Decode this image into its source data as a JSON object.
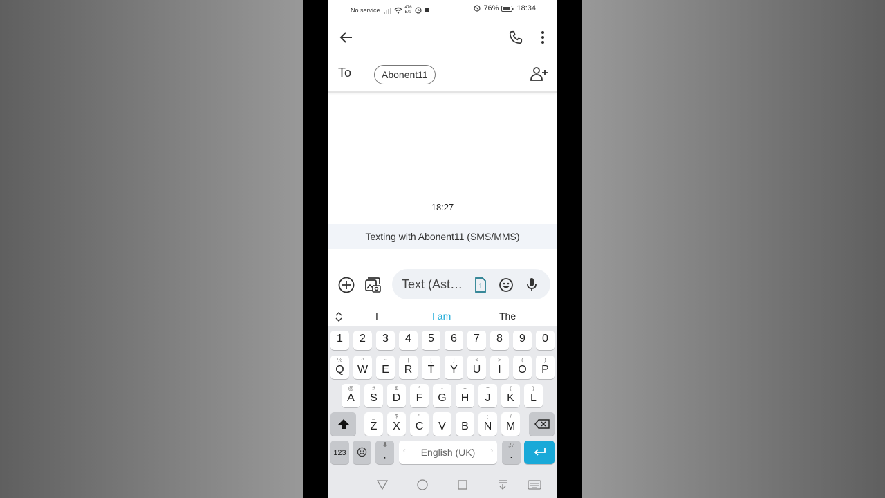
{
  "status": {
    "carrier": "No service",
    "speed_top": "476",
    "speed_bottom": "B/s",
    "battery": "76%",
    "clock": "18:34"
  },
  "header": {
    "recipient_label": "To",
    "recipient_chip": "Abonent11"
  },
  "conversation": {
    "timestamp": "18:27",
    "info": "Texting with Abonent11 (SMS/MMS)"
  },
  "compose": {
    "placeholder": "Text (Ast…",
    "sim_badge": "1"
  },
  "suggestions": [
    "I",
    "I am",
    "The"
  ],
  "keyboard": {
    "numbers": [
      "1",
      "2",
      "3",
      "4",
      "5",
      "6",
      "7",
      "8",
      "9",
      "0"
    ],
    "row1": [
      {
        "k": "Q",
        "s": "%"
      },
      {
        "k": "W",
        "s": "^"
      },
      {
        "k": "E",
        "s": "~"
      },
      {
        "k": "R",
        "s": "|"
      },
      {
        "k": "T",
        "s": "["
      },
      {
        "k": "Y",
        "s": "]"
      },
      {
        "k": "U",
        "s": "<"
      },
      {
        "k": "I",
        "s": ">"
      },
      {
        "k": "O",
        "s": "("
      },
      {
        "k": "P",
        "s": ")"
      }
    ],
    "row2": [
      {
        "k": "A",
        "s": "@"
      },
      {
        "k": "S",
        "s": "#"
      },
      {
        "k": "D",
        "s": "&"
      },
      {
        "k": "F",
        "s": "*"
      },
      {
        "k": "G",
        "s": "-"
      },
      {
        "k": "H",
        "s": "+"
      },
      {
        "k": "J",
        "s": "="
      },
      {
        "k": "K",
        "s": "("
      },
      {
        "k": "L",
        "s": ")"
      }
    ],
    "row3": [
      {
        "k": "Z",
        "s": "_"
      },
      {
        "k": "X",
        "s": "$"
      },
      {
        "k": "C",
        "s": "\""
      },
      {
        "k": "V",
        "s": "'"
      },
      {
        "k": "B",
        "s": ":"
      },
      {
        "k": "N",
        "s": ";"
      },
      {
        "k": "M",
        "s": "/"
      }
    ],
    "sym_key": "123",
    "comma": ",",
    "space_label": "English (UK)",
    "period": ".",
    "period_sup": ",!?"
  },
  "colors": {
    "accent": "#19a9d8",
    "suggestion_highlight": "#19a9d8",
    "chrome": "#e8e9ec"
  }
}
